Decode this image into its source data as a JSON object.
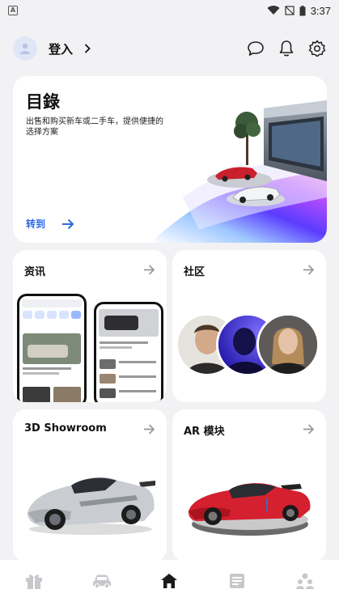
{
  "status_bar": {
    "time": "3:37"
  },
  "header": {
    "login_label": "登入"
  },
  "hero": {
    "title": "目錄",
    "description": "出售和购买新车或二手车，提供便捷的选择方案",
    "link_label": "转到"
  },
  "tiles": [
    {
      "title": "资讯"
    },
    {
      "title": "社区"
    },
    {
      "title": "3D Showroom"
    },
    {
      "title": "AR 模块"
    }
  ],
  "colors": {
    "accent": "#2f6ae0",
    "background": "#f2f2f4",
    "nav_inactive": "#c8c8cc",
    "nav_active": "#1a1a1a"
  },
  "icons": {
    "header": [
      "user-icon",
      "chevron-right-icon",
      "chat-icon",
      "bell-icon",
      "settings-icon"
    ],
    "bottom_nav": [
      "gift-icon",
      "car-icon",
      "home-icon",
      "news-icon",
      "community-icon"
    ]
  }
}
